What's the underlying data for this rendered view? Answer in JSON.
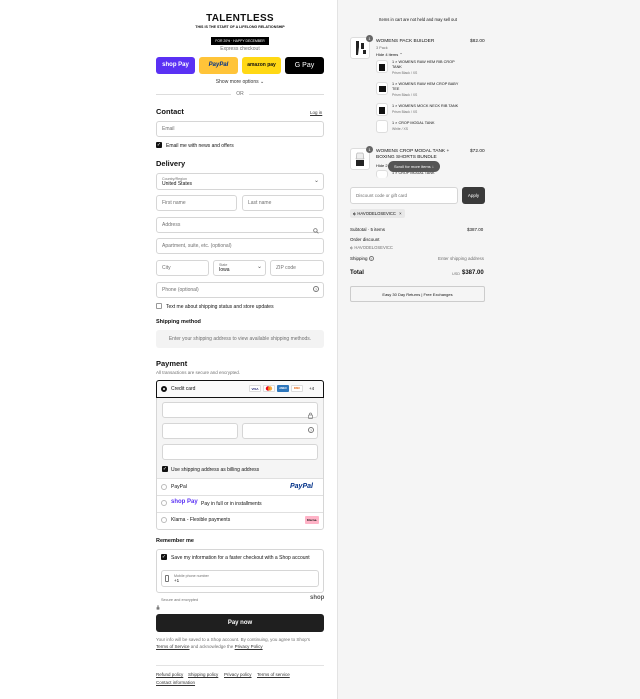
{
  "brand": {
    "name": "TALENTLESS",
    "tagline": "THIS IS THE START OF A LIFELONG RELATIONSHIP",
    "promo": "FOR 20% · HAPPY DECEMBER"
  },
  "express": {
    "title": "Express checkout",
    "shop_pay": "shop Pay",
    "paypal": "PayPal",
    "amazon_pay": "amazon pay",
    "google_pay": "G Pay",
    "more": "Show more options",
    "or": "OR"
  },
  "contact": {
    "title": "Contact",
    "login": "Log in",
    "email_placeholder": "Email",
    "news_label": "Email me with news and offers"
  },
  "delivery": {
    "title": "Delivery",
    "country_label": "Country/Region",
    "country_value": "United States",
    "first_name": "First name",
    "last_name": "Last name",
    "address": "Address",
    "apartment": "Apartment, suite, etc. (optional)",
    "city": "City",
    "state_label": "State",
    "state_value": "Iowa",
    "zip": "ZIP code",
    "phone": "Phone (optional)",
    "text_label": "Text me about shipping status and store updates"
  },
  "shipping_method": {
    "title": "Shipping method",
    "info": "Enter your shipping address to view available shipping methods."
  },
  "payment": {
    "title": "Payment",
    "subtitle": "All transactions are secure and encrypted.",
    "credit_card": "Credit card",
    "more_cards": "+4",
    "card_brands": [
      "VISA",
      "MC",
      "AMEX",
      "DISC"
    ],
    "billing_label": "Use shipping address as billing address",
    "paypal": "PayPal",
    "paypal_logo": "PayPal",
    "shop_pay_logo": "shop Pay",
    "shop_pay": "Pay in full or in installments",
    "klarna": "Klarna - Flexible payments",
    "klarna_logo": "Klarna."
  },
  "remember": {
    "title": "Remember me",
    "save_label": "Save my information for a faster checkout with a Shop account",
    "phone_label": "Mobile phone number",
    "phone_value": "+1",
    "secure": "Secure and encrypted",
    "shop_logo": "shop"
  },
  "pay_now": "Pay now",
  "disclaimer_1": "Your info will be saved to a Shop account. By continuing, you agree to Shop's",
  "disclaimer_terms": "Terms of Service",
  "disclaimer_mid": "and acknowledge the",
  "disclaimer_privacy": "Privacy Policy",
  "footer": [
    "Refund policy",
    "Shipping policy",
    "Privacy policy",
    "Terms of service",
    "Contact information"
  ],
  "cart": {
    "notice": "Items in cart are not held and may sell out",
    "item1": {
      "badge": "1",
      "title": "WOMENS PACK BUILDER",
      "variant": "3 Pack",
      "toggle": "Hide 4 items",
      "price": "$82.00",
      "subs": [
        {
          "title": "1 × WOMENS RAW HEM RIB CROP TANK",
          "variant": "Prism Black / XS"
        },
        {
          "title": "1 × WOMENS RAW HEM CROP BABY TEE",
          "variant": "Prism Black / XS"
        },
        {
          "title": "1 × WOMENS MOCK NECK RIB TANK",
          "variant": "Prism Black / XS"
        },
        {
          "title": "1 × CROP MODAL TANK",
          "variant": "White / XS"
        }
      ]
    },
    "item2": {
      "badge": "1",
      "title": "WOMENS CROP MODAL TANK + BOXING SHORTS BUNDLE",
      "toggle": "Hide 2",
      "sub": "1 × CROP MODAL TANK",
      "price": "$72.00"
    },
    "scroll_hint": "Scroll for more items",
    "discount_placeholder": "Discount code or gift card",
    "apply": "Apply",
    "code": "HAVODELOSEVICC",
    "subtotal_label": "Subtotal · 5 items",
    "subtotal": "$387.00",
    "order_discount": "Order discount",
    "discount_code": "HAVODELOSEVICC",
    "shipping_label": "Shipping",
    "shipping_value": "Enter shipping address",
    "total_label": "Total",
    "currency": "USD",
    "total": "$387.00",
    "returns": "Easy 30 Day Returns | Free Exchanges"
  }
}
